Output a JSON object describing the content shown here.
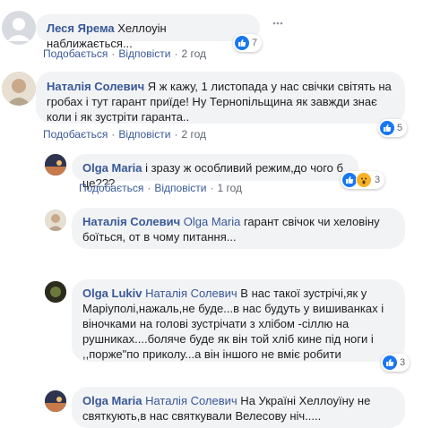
{
  "comments": [
    {
      "author": "Леся Ярема",
      "text": " Хеллоуін наближається...",
      "like": "Подобається",
      "reply": "Відповісти",
      "time": "2 год",
      "reactions": "7"
    },
    {
      "author": "Наталія Солевич",
      "text_lines": [
        " Я ж кажу, 1 листопада у нас свічки світять на",
        "гробах і тут гарант приїде! Ну Тернопільщина як завжди знає",
        "коли і як зустріти гаранта.."
      ],
      "like": "Подобається",
      "reply": "Відповісти",
      "time": "2 год",
      "reactions": "5"
    }
  ],
  "replies": [
    {
      "author": "Olga Maria",
      "text": " і зразу ж особливий режим,до чого б це???",
      "like": "Подобається",
      "reply": "Відповісти",
      "time": "1 год",
      "reactions": "3"
    },
    {
      "author": "Наталія Солевич",
      "mention": "Olga Maria",
      "text_lines": [
        " гарант свічок чи хеловіну",
        "боїться, от в чому питання..."
      ]
    },
    {
      "author": "Olga Lukiv",
      "mention": "Наталія Солевич",
      "text_lines": [
        " В нас такої зустрічі,як у",
        "Маріуполі,нажаль,не буде...в нас будуть у вишиванках і",
        "віночками на голові зустрічати з хлібом -сіллю на",
        "рушниках....боляче буде як він той хліб кине під ноги і",
        ",,порже\"по приколу...а він іншого не вміє робити"
      ],
      "reactions": "3"
    },
    {
      "author": "Olga Maria",
      "mention": "Наталія Солевич",
      "text_lines": [
        " На Україні Хеллоуїну не",
        "святкують,в нас святкували Велесову ніч....."
      ]
    }
  ],
  "colors": {
    "link": "#385898",
    "bubble": "#f2f3f5",
    "like": "#1877f2",
    "wow": "#f7b125"
  }
}
